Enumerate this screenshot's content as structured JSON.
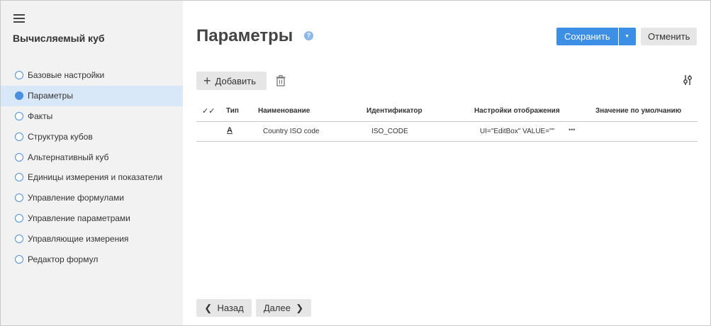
{
  "sidebar": {
    "title": "Вычисляемый куб",
    "steps": [
      {
        "label": "Базовые настройки",
        "active": false
      },
      {
        "label": "Параметры",
        "active": true
      },
      {
        "label": "Факты",
        "active": false
      },
      {
        "label": "Структура кубов",
        "active": false
      },
      {
        "label": "Альтернативный куб",
        "active": false
      },
      {
        "label": "Единицы измерения и показатели",
        "active": false
      },
      {
        "label": "Управление формулами",
        "active": false
      },
      {
        "label": "Управление параметрами",
        "active": false
      },
      {
        "label": "Управляющие измерения",
        "active": false
      },
      {
        "label": "Редактор формул",
        "active": false
      }
    ]
  },
  "header": {
    "title": "Параметры",
    "help_glyph": "?",
    "save_label": "Сохранить",
    "cancel_label": "Отменить"
  },
  "toolbar": {
    "add_label": "Добавить"
  },
  "table": {
    "columns": [
      "Тип",
      "Наименование",
      "Идентификатор",
      "Настройки отображения",
      "Значение по умолчанию"
    ],
    "rows": [
      {
        "type": "A",
        "name": "Country ISO code",
        "id": "ISO_CODE",
        "display": "UI=\"EditBox\" VALUE=\"\"",
        "default": ""
      }
    ]
  },
  "footer": {
    "back_label": "Назад",
    "next_label": "Далее"
  },
  "colors": {
    "accent": "#3d8fe6",
    "sidebar_bg": "#f2f2f2",
    "active_step_bg": "#d9e8f8",
    "button_bg": "#e6e6e6"
  }
}
